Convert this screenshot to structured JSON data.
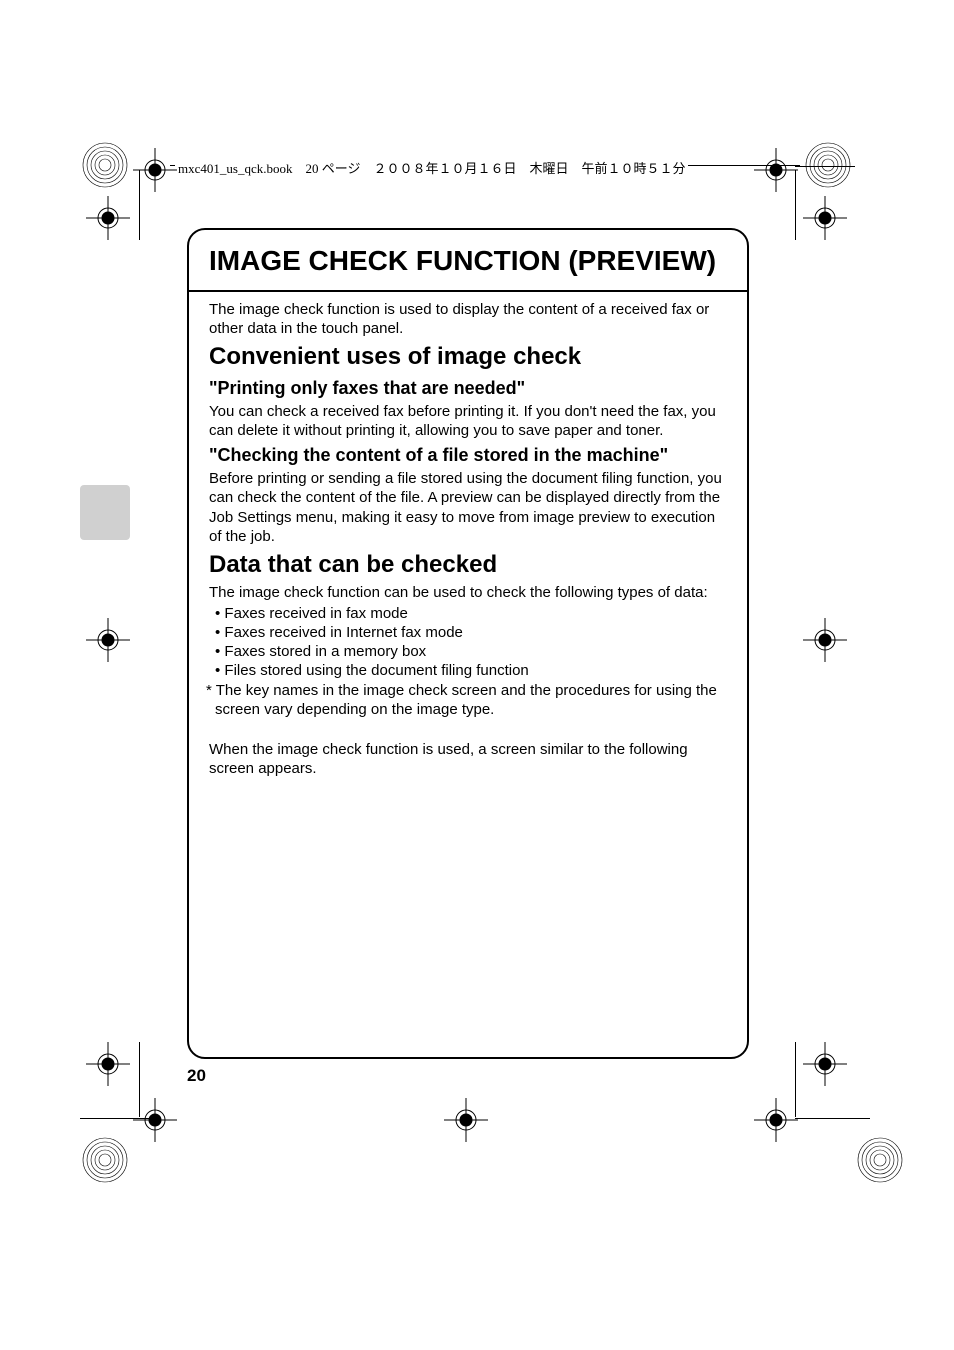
{
  "header": {
    "text": "mxc401_us_qck.book　20 ページ　２００８年１０月１６日　木曜日　午前１０時５１分"
  },
  "title": "IMAGE CHECK FUNCTION (PREVIEW)",
  "intro": "The image check function is used to display the content of a received fax or other data in the touch panel.",
  "section1": {
    "heading": "Convenient uses of image check",
    "sub1": {
      "heading": "\"Printing only faxes that are needed\"",
      "body": "You can check a received fax before printing it. If you don't need the fax, you can delete it without printing it, allowing you to save paper and toner."
    },
    "sub2": {
      "heading": "\"Checking the content of a file stored in the machine\"",
      "body": "Before printing or sending a file stored using the document filing function, you can check the content of the file. A preview can be displayed directly from the Job Settings menu, making it easy to move from image preview to execution of the job."
    }
  },
  "section2": {
    "heading": "Data that can be checked",
    "intro": "The image check function can be used to check the following types of data:",
    "items": [
      "Faxes received in fax mode",
      "Faxes received in Internet fax mode",
      "Faxes stored in a memory box",
      "Files stored using the document filing function"
    ],
    "note": "* The key names in the image check screen and the procedures for using the screen vary depending on the image type.",
    "followup": "When the image check function is used, a screen similar to the following screen appears."
  },
  "page_number": "20"
}
